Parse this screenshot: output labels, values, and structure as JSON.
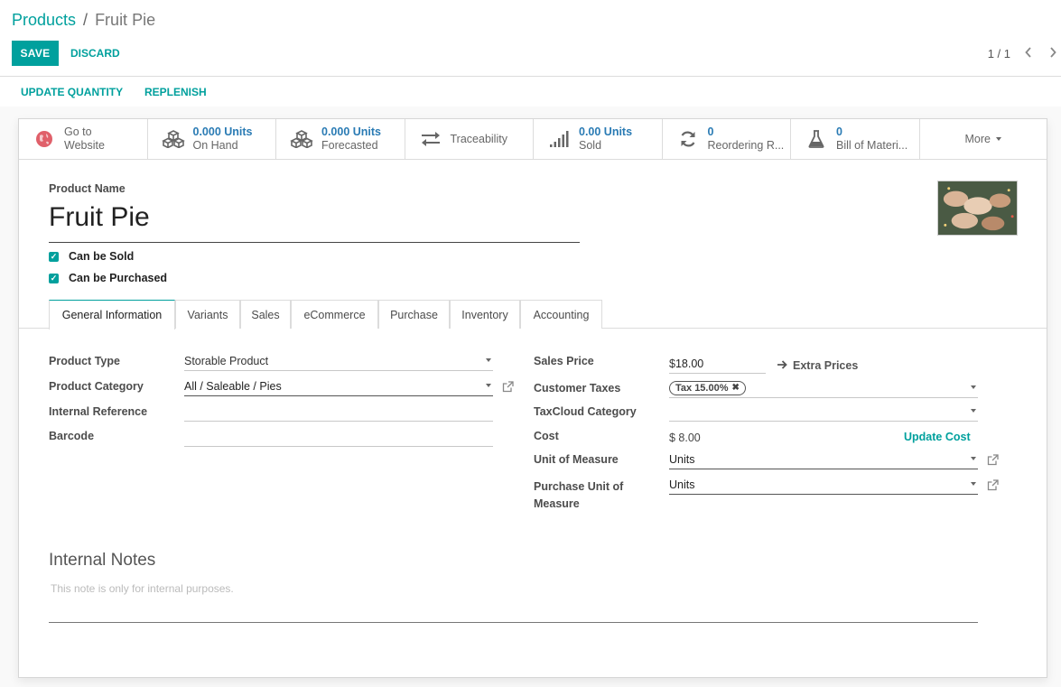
{
  "breadcrumb": {
    "parent": "Products",
    "separator": "/",
    "current": "Fruit Pie"
  },
  "toolbar": {
    "save_label": "SAVE",
    "discard_label": "DISCARD"
  },
  "pager": {
    "text": "1 / 1"
  },
  "actions": {
    "update_quantity": "UPDATE QUANTITY",
    "replenish": "REPLENISH"
  },
  "smart_buttons": [
    {
      "icon": "globe-icon",
      "value": "Go to",
      "label": "Website"
    },
    {
      "icon": "cubes-icon",
      "value": "0.000 Units",
      "label": "On Hand"
    },
    {
      "icon": "cubes-icon",
      "value": "0.000 Units",
      "label": "Forecasted"
    },
    {
      "icon": "exchange-icon",
      "label": "Traceability"
    },
    {
      "icon": "signal-icon",
      "value": "0.00 Units",
      "label": "Sold"
    },
    {
      "icon": "refresh-icon",
      "value": "0",
      "label": "Reordering R..."
    },
    {
      "icon": "flask-icon",
      "value": "0",
      "label": "Bill of Materi..."
    },
    {
      "label": "More"
    }
  ],
  "product": {
    "name_label": "Product Name",
    "name": "Fruit Pie",
    "can_be_sold": "Can be Sold",
    "can_be_purchased": "Can be Purchased"
  },
  "tabs": [
    "General Information",
    "Variants",
    "Sales",
    "eCommerce",
    "Purchase",
    "Inventory",
    "Accounting"
  ],
  "general": {
    "product_type_label": "Product Type",
    "product_type": "Storable Product",
    "product_category_label": "Product Category",
    "product_category": "All / Saleable / Pies",
    "internal_reference_label": "Internal Reference",
    "internal_reference": "",
    "barcode_label": "Barcode",
    "barcode": "",
    "sales_price_label": "Sales Price",
    "sales_price_currency": "$",
    "sales_price": "18.00",
    "extra_prices": "Extra Prices",
    "customer_taxes_label": "Customer Taxes",
    "customer_tax_tag": "Tax 15.00%",
    "taxcloud_label": "TaxCloud Category",
    "cost_label": "Cost",
    "cost": "$ 8.00",
    "update_cost": "Update Cost",
    "uom_label": "Unit of Measure",
    "uom": "Units",
    "purchase_uom_label_1": "Purchase Unit of",
    "purchase_uom_label_2": "Measure",
    "purchase_uom": "Units"
  },
  "notes": {
    "title": "Internal Notes",
    "placeholder": "This note is only for internal purposes."
  },
  "colors": {
    "accent": "#00a09d",
    "link_blue": "#2a7bb4"
  }
}
